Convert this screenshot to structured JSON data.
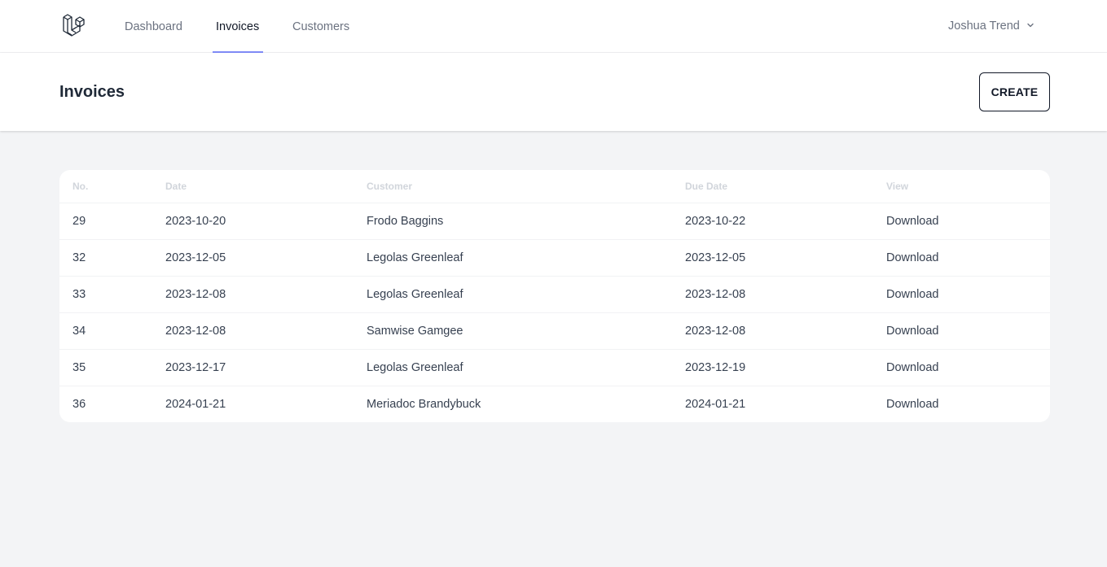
{
  "nav": {
    "logo_icon": "laravel-logo-icon",
    "links": [
      "Dashboard",
      "Invoices",
      "Customers"
    ],
    "active_link": "Invoices",
    "accent_color": "#818cf8",
    "user_name": "Joshua Trend",
    "user_menu_icon": "chevron-down-icon"
  },
  "header": {
    "title": "Invoices",
    "create_label": "CREATE"
  },
  "table": {
    "columns": [
      "No.",
      "Date",
      "Customer",
      "Due Date",
      "View"
    ],
    "rows": [
      {
        "no": "29",
        "date": "2023-10-20",
        "customer": "Frodo Baggins",
        "due": "2023-10-22",
        "view": "Download"
      },
      {
        "no": "32",
        "date": "2023-12-05",
        "customer": "Legolas Greenleaf",
        "due": "2023-12-05",
        "view": "Download"
      },
      {
        "no": "33",
        "date": "2023-12-08",
        "customer": "Legolas Greenleaf",
        "due": "2023-12-08",
        "view": "Download"
      },
      {
        "no": "34",
        "date": "2023-12-08",
        "customer": "Samwise Gamgee",
        "due": "2023-12-08",
        "view": "Download"
      },
      {
        "no": "35",
        "date": "2023-12-17",
        "customer": "Legolas Greenleaf",
        "due": "2023-12-19",
        "view": "Download"
      },
      {
        "no": "36",
        "date": "2024-01-21",
        "customer": "Meriadoc Brandybuck",
        "due": "2024-01-21",
        "view": "Download"
      }
    ]
  }
}
